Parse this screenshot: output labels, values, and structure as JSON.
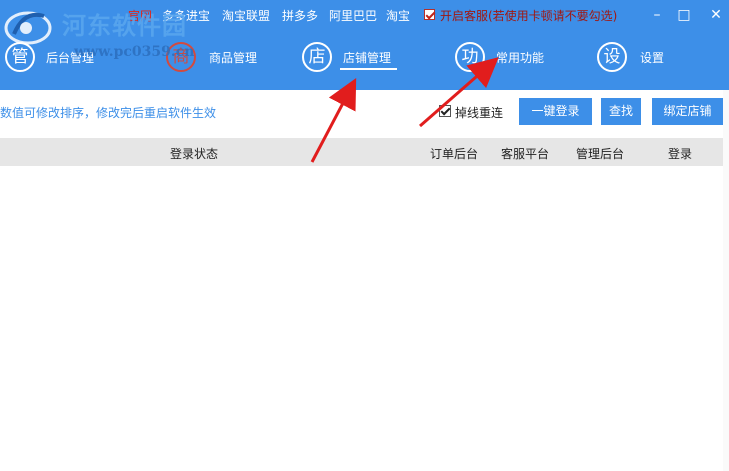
{
  "topbar": {
    "links": [
      "官网",
      "多多进宝",
      "淘宝联盟",
      "拼多多",
      "阿里巴巴",
      "淘宝"
    ],
    "kefu_label": "开启客服(若使用卡顿请不要勾选)",
    "kefu_checked": true,
    "minimize": "–",
    "maximize": "□",
    "close": "✕"
  },
  "watermark": {
    "title": "河东软件园",
    "url": "www.pc0359.cn"
  },
  "nav": {
    "items": [
      {
        "icon_char": "管",
        "label": "后台管理"
      },
      {
        "icon_char": "商",
        "label": "商品管理"
      },
      {
        "icon_char": "店",
        "label": "店铺管理"
      },
      {
        "icon_char": "功",
        "label": "常用功能"
      },
      {
        "icon_char": "设",
        "label": "设置"
      }
    ],
    "active_index": 2
  },
  "toolbar": {
    "hint": "数值可修改排序，修改完后重启软件生效",
    "reconnect_label": "掉线重连",
    "reconnect_checked": true,
    "buttons": [
      "一键登录",
      "查找",
      "绑定店铺"
    ]
  },
  "table": {
    "columns": [
      "登录状态",
      "订单后台",
      "客服平台",
      "管理后台",
      "登录"
    ],
    "rows": []
  },
  "colors": {
    "header_bg": "#3d8fe8",
    "accent_red": "#e0271a",
    "table_header_bg": "#e6e6e6"
  }
}
